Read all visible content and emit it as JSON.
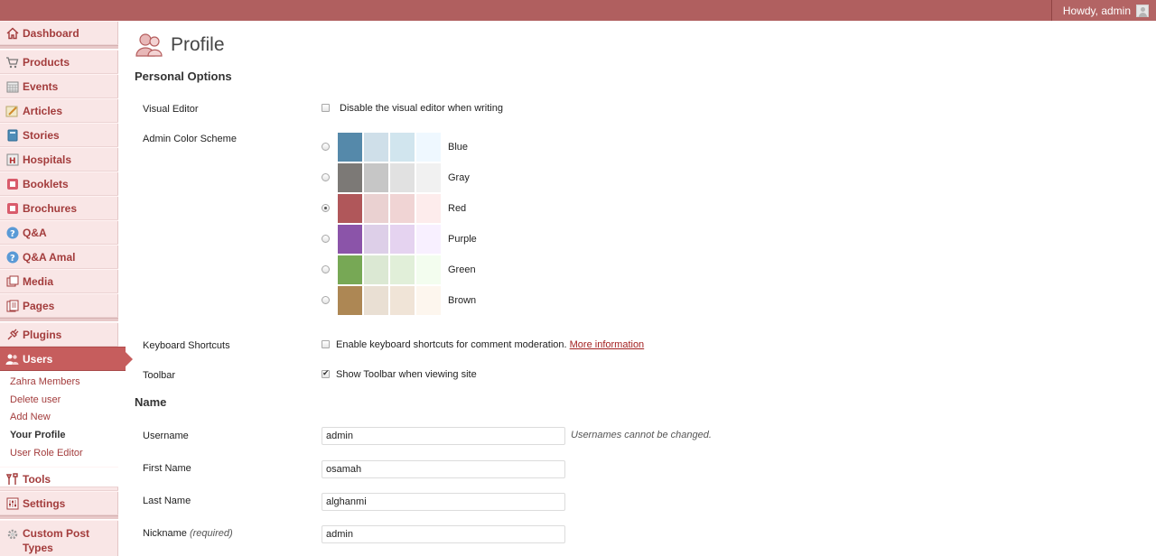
{
  "header": {
    "greeting": "Howdy, admin"
  },
  "sidebar": {
    "items": [
      {
        "label": "Dashboard"
      },
      {
        "label": "Products"
      },
      {
        "label": "Events"
      },
      {
        "label": "Articles"
      },
      {
        "label": "Stories"
      },
      {
        "label": "Hospitals"
      },
      {
        "label": "Booklets"
      },
      {
        "label": "Brochures"
      },
      {
        "label": "Q&A"
      },
      {
        "label": "Q&A Amal"
      },
      {
        "label": "Media"
      },
      {
        "label": "Pages"
      },
      {
        "label": "Plugins"
      },
      {
        "label": "Users"
      },
      {
        "label": "Tools"
      },
      {
        "label": "Settings"
      },
      {
        "label": "Custom Post Types"
      }
    ],
    "users_submenu": [
      {
        "label": "Zahra Members"
      },
      {
        "label": "Delete user"
      },
      {
        "label": "Add New"
      },
      {
        "label": "Your Profile"
      },
      {
        "label": "User Role Editor"
      }
    ]
  },
  "page": {
    "title": "Profile"
  },
  "personal_options": {
    "heading": "Personal Options",
    "visual_editor": {
      "label": "Visual Editor",
      "option_text": "Disable the visual editor when writing",
      "checked": false
    },
    "color_scheme": {
      "label": "Admin Color Scheme",
      "selected": "Red",
      "schemes": [
        {
          "name": "Blue",
          "colors": [
            "#5589aa",
            "#cfdfe9",
            "#d1e5ee",
            "#eff8ff"
          ]
        },
        {
          "name": "Gray",
          "colors": [
            "#7c7976",
            "#c6c6c6",
            "#e1e1e1",
            "#f1f1f1"
          ]
        },
        {
          "name": "Red",
          "colors": [
            "#b0575a",
            "#ead1d1",
            "#f0d4d4",
            "#fdecec"
          ]
        },
        {
          "name": "Purple",
          "colors": [
            "#8b54a9",
            "#ddcfe8",
            "#e5d3f0",
            "#f8f0ff"
          ]
        },
        {
          "name": "Green",
          "colors": [
            "#77a855",
            "#dbe8d3",
            "#e1efd9",
            "#f3fdef"
          ]
        },
        {
          "name": "Brown",
          "colors": [
            "#ad8754",
            "#e9dfd3",
            "#f0e4d7",
            "#fdf6ee"
          ]
        }
      ]
    },
    "keyboard_shortcuts": {
      "label": "Keyboard Shortcuts",
      "option_text": "Enable keyboard shortcuts for comment moderation.",
      "link_text": "More information",
      "checked": false
    },
    "toolbar": {
      "label": "Toolbar",
      "option_text": "Show Toolbar when viewing site",
      "checked": true
    }
  },
  "name_section": {
    "heading": "Name",
    "username": {
      "label": "Username",
      "value": "admin",
      "hint": "Usernames cannot be changed."
    },
    "first_name": {
      "label": "First Name",
      "value": "osamah"
    },
    "last_name": {
      "label": "Last Name",
      "value": "alghanmi"
    },
    "nickname": {
      "label": "Nickname",
      "required_text": "(required)",
      "value": "admin"
    }
  }
}
